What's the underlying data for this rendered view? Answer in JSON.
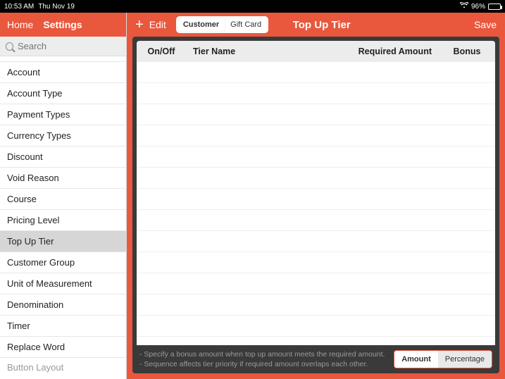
{
  "statusbar": {
    "time": "10:53 AM",
    "date": "Thu Nov 19",
    "battery_pct": "96%"
  },
  "sidebar": {
    "home_label": "Home",
    "title": "Settings",
    "search_placeholder": "Search",
    "items": [
      {
        "label": "Account"
      },
      {
        "label": "Account Type"
      },
      {
        "label": "Payment Types"
      },
      {
        "label": "Currency Types"
      },
      {
        "label": "Discount"
      },
      {
        "label": "Void Reason"
      },
      {
        "label": "Course"
      },
      {
        "label": "Pricing Level"
      },
      {
        "label": "Top Up Tier",
        "selected": true
      },
      {
        "label": "Customer Group"
      },
      {
        "label": "Unit of Measurement"
      },
      {
        "label": "Denomination"
      },
      {
        "label": "Timer"
      },
      {
        "label": "Replace Word"
      },
      {
        "label": "Button Layout",
        "partial": true
      }
    ]
  },
  "header": {
    "edit_label": "Edit",
    "segment": {
      "customer": "Customer",
      "giftcard": "Gift Card",
      "active": "customer"
    },
    "title": "Top Up Tier",
    "save_label": "Save"
  },
  "table": {
    "columns": {
      "onoff": "On/Off",
      "name": "Tier Name",
      "required": "Required Amount",
      "bonus": "Bonus"
    },
    "rows": []
  },
  "footer": {
    "note1": "- Specify a bonus amount when top up amount meets the required amount.",
    "note2": "- Sequence affects tier priority if required amount overlaps each other.",
    "segment": {
      "amount": "Amount",
      "percentage": "Percentage",
      "active": "amount"
    }
  }
}
